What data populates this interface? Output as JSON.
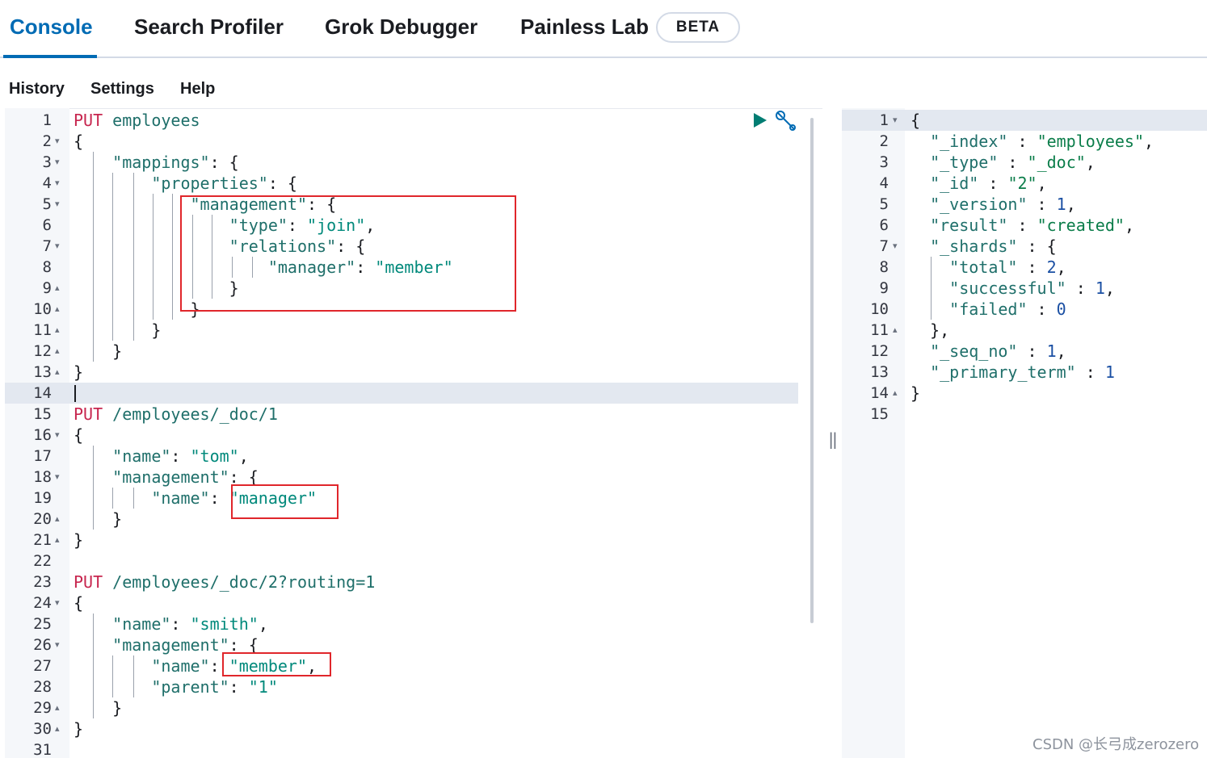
{
  "tabs": [
    {
      "label": "Console",
      "active": true
    },
    {
      "label": "Search Profiler",
      "active": false
    },
    {
      "label": "Grok Debugger",
      "active": false
    },
    {
      "label": "Painless Lab",
      "active": false
    }
  ],
  "beta_badge": "BETA",
  "menu": {
    "history": "History",
    "settings": "Settings",
    "help": "Help"
  },
  "request_editor": {
    "current_line": 14,
    "lines": [
      {
        "n": "1",
        "fold": "",
        "method": "PUT",
        "text": " employees"
      },
      {
        "n": "2",
        "fold": "▾",
        "method": "",
        "text": "{"
      },
      {
        "n": "3",
        "fold": "▾",
        "method": "",
        "text": "    \"mappings\": {"
      },
      {
        "n": "4",
        "fold": "▾",
        "method": "",
        "text": "        \"properties\": {"
      },
      {
        "n": "5",
        "fold": "▾",
        "method": "",
        "text": "            \"management\": {"
      },
      {
        "n": "6",
        "fold": "",
        "method": "",
        "text": "                \"type\": \"join\","
      },
      {
        "n": "7",
        "fold": "▾",
        "method": "",
        "text": "                \"relations\": {"
      },
      {
        "n": "8",
        "fold": "",
        "method": "",
        "text": "                    \"manager\": \"member\""
      },
      {
        "n": "9",
        "fold": "▴",
        "method": "",
        "text": "                }"
      },
      {
        "n": "10",
        "fold": "▴",
        "method": "",
        "text": "            }"
      },
      {
        "n": "11",
        "fold": "▴",
        "method": "",
        "text": "        }"
      },
      {
        "n": "12",
        "fold": "▴",
        "method": "",
        "text": "    }"
      },
      {
        "n": "13",
        "fold": "▴",
        "method": "",
        "text": "}"
      },
      {
        "n": "14",
        "fold": "",
        "method": "",
        "text": ""
      },
      {
        "n": "15",
        "fold": "",
        "method": "PUT",
        "text": " /employees/_doc/1"
      },
      {
        "n": "16",
        "fold": "▾",
        "method": "",
        "text": "{"
      },
      {
        "n": "17",
        "fold": "",
        "method": "",
        "text": "    \"name\": \"tom\","
      },
      {
        "n": "18",
        "fold": "▾",
        "method": "",
        "text": "    \"management\": {"
      },
      {
        "n": "19",
        "fold": "",
        "method": "",
        "text": "        \"name\": \"manager\""
      },
      {
        "n": "20",
        "fold": "▴",
        "method": "",
        "text": "    }"
      },
      {
        "n": "21",
        "fold": "▴",
        "method": "",
        "text": "}"
      },
      {
        "n": "22",
        "fold": "",
        "method": "",
        "text": ""
      },
      {
        "n": "23",
        "fold": "",
        "method": "PUT",
        "text": " /employees/_doc/2?routing=1"
      },
      {
        "n": "24",
        "fold": "▾",
        "method": "",
        "text": "{"
      },
      {
        "n": "25",
        "fold": "",
        "method": "",
        "text": "    \"name\": \"smith\","
      },
      {
        "n": "26",
        "fold": "▾",
        "method": "",
        "text": "    \"management\": {"
      },
      {
        "n": "27",
        "fold": "",
        "method": "",
        "text": "        \"name\": \"member\","
      },
      {
        "n": "28",
        "fold": "",
        "method": "",
        "text": "        \"parent\": \"1\""
      },
      {
        "n": "29",
        "fold": "▴",
        "method": "",
        "text": "    }"
      },
      {
        "n": "30",
        "fold": "▴",
        "method": "",
        "text": "}"
      },
      {
        "n": "31",
        "fold": "",
        "method": "",
        "text": ""
      }
    ]
  },
  "response_editor": {
    "current_line": 1,
    "lines": [
      {
        "n": "1",
        "fold": "▾",
        "text": "{"
      },
      {
        "n": "2",
        "fold": "",
        "text": "  \"_index\" : \"employees\","
      },
      {
        "n": "3",
        "fold": "",
        "text": "  \"_type\" : \"_doc\","
      },
      {
        "n": "4",
        "fold": "",
        "text": "  \"_id\" : \"2\","
      },
      {
        "n": "5",
        "fold": "",
        "text": "  \"_version\" : 1,"
      },
      {
        "n": "6",
        "fold": "",
        "text": "  \"result\" : \"created\","
      },
      {
        "n": "7",
        "fold": "▾",
        "text": "  \"_shards\" : {"
      },
      {
        "n": "8",
        "fold": "",
        "text": "    \"total\" : 2,"
      },
      {
        "n": "9",
        "fold": "",
        "text": "    \"successful\" : 1,"
      },
      {
        "n": "10",
        "fold": "",
        "text": "    \"failed\" : 0"
      },
      {
        "n": "11",
        "fold": "▴",
        "text": "  },"
      },
      {
        "n": "12",
        "fold": "",
        "text": "  \"_seq_no\" : 1,"
      },
      {
        "n": "13",
        "fold": "",
        "text": "  \"_primary_term\" : 1"
      },
      {
        "n": "14",
        "fold": "▴",
        "text": "}"
      },
      {
        "n": "15",
        "fold": "",
        "text": ""
      }
    ]
  },
  "icons": {
    "run": "play-icon",
    "settings": "wrench-icon"
  },
  "divider_glyph": "‖",
  "watermark": "CSDN @长弓成zerozero",
  "colors": {
    "accent": "#006bb4",
    "method": "#c7254e",
    "string": "#00897b",
    "highlight_box": "#e0262b",
    "run_button": "#017d73"
  }
}
